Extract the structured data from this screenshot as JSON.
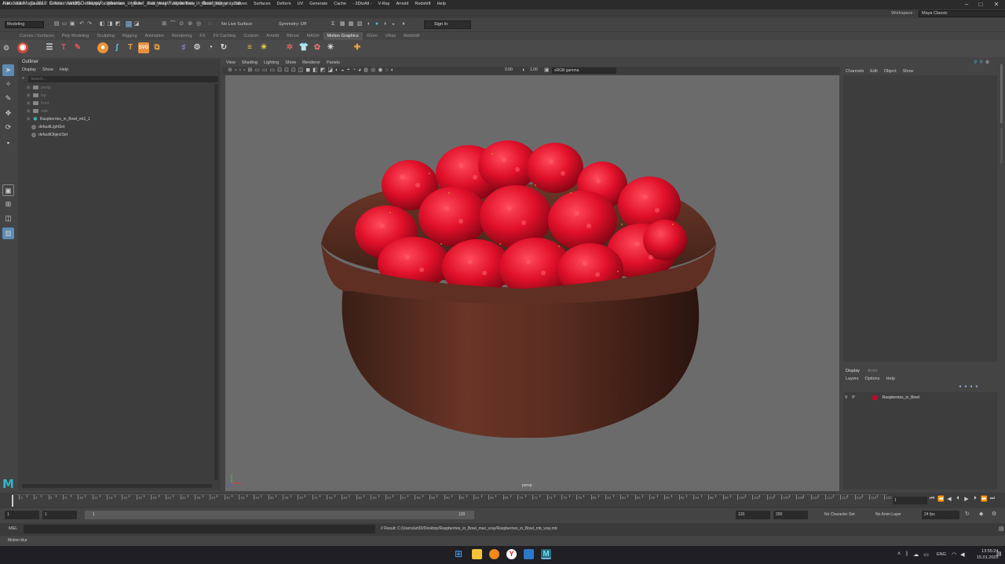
{
  "window": {
    "title": "Autodesk Maya 2018: C:\\Users\\art30\\Desktop\\Raspberries_in_Bowl_max_vray\\Raspberries_in_Bowl_mb_vray.mb",
    "minimize_glyph": "–",
    "maximize_glyph": "□",
    "close_glyph": "✕"
  },
  "menubar": {
    "items": [
      "File",
      "Edit",
      "Create",
      "Select",
      "Modify",
      "Display",
      "Windows",
      "Mesh",
      "Edit Mesh",
      "Mesh Tools",
      "Mesh Display",
      "Curves",
      "Surfaces",
      "Deform",
      "UV",
      "Generate",
      "Cache",
      "- 3DtoAll -",
      "V-Ray",
      "Arnold",
      "Redshift",
      "Help"
    ],
    "workspace_label": "Workspace :",
    "workspace_value": "Maya Classic"
  },
  "statusline": {
    "mode": "Modeling",
    "live_surface": "No Live Surface",
    "symmetry": "Symmetry: Off",
    "sign_in": "Sign In"
  },
  "shelf": {
    "tabs": [
      "Curves / Surfaces",
      "Poly Modeling",
      "Sculpting",
      "Rigging",
      "Animation",
      "Rendering",
      "FX",
      "FX Caching",
      "Custom",
      "Arnold",
      "Bifrost",
      "MASH",
      "Motion Graphics",
      "XGen",
      "VRay",
      "Redshift"
    ],
    "active_tab": "Motion Graphics"
  },
  "outliner": {
    "title": "Outliner",
    "menus": [
      "Display",
      "Show",
      "Help"
    ],
    "search_placeholder": "Search...",
    "items": [
      {
        "label": "persp",
        "icon": "camera-icon",
        "dim": true
      },
      {
        "label": "top",
        "icon": "camera-icon",
        "dim": true
      },
      {
        "label": "front",
        "icon": "camera-icon",
        "dim": true
      },
      {
        "label": "side",
        "icon": "camera-icon",
        "dim": true
      },
      {
        "label": "Raspberries_in_Bowl_mt1_1",
        "icon": "group-icon",
        "dim": false
      },
      {
        "label": "defaultLightSet",
        "icon": "set-icon",
        "dim": false
      },
      {
        "label": "defaultObjectSet",
        "icon": "set-icon",
        "dim": false
      }
    ]
  },
  "viewport": {
    "menus": [
      "View",
      "Shading",
      "Lighting",
      "Show",
      "Renderer",
      "Panels"
    ],
    "exposure": "0.00",
    "gamma": "1.00",
    "color_space": "sRGB gamma",
    "camera_label": "persp"
  },
  "channel_box": {
    "menus": [
      "Channels",
      "Edit",
      "Object",
      "Show"
    ]
  },
  "layer_editor": {
    "tabs": [
      "Display",
      "Anim"
    ],
    "active_tab": "Display",
    "menus": [
      "Layers",
      "Options",
      "Help"
    ],
    "layer": {
      "v": "V",
      "p": "P",
      "name": "Raspberries_in_Bowl",
      "color": "#b01030"
    }
  },
  "timeline": {
    "ticks": [
      "2",
      "4",
      "6",
      "8",
      "10",
      "12",
      "14",
      "16",
      "18",
      "20",
      "22",
      "24",
      "26",
      "28",
      "30",
      "32",
      "34",
      "36",
      "38",
      "40",
      "42",
      "44",
      "46",
      "48",
      "50",
      "52",
      "54",
      "56",
      "58",
      "60",
      "62",
      "64",
      "66",
      "68",
      "70",
      "72",
      "74",
      "76",
      "78",
      "80",
      "82",
      "84",
      "86",
      "88",
      "90",
      "92",
      "94",
      "96",
      "98",
      "100",
      "102",
      "104",
      "106",
      "108",
      "110",
      "112",
      "114",
      "116",
      "118",
      "120"
    ],
    "current_frame": "1",
    "playback_glyphs": [
      "⏮",
      "⏪",
      "◀",
      "⏴",
      "▶",
      "⏵",
      "⏩",
      "⏭"
    ]
  },
  "range": {
    "start": "1",
    "anim_start": "1",
    "slider_start": "1",
    "slider_end": "120",
    "end": "120",
    "anim_end": "200",
    "character_set": "No Character Set",
    "anim_layer": "No Anim Layer",
    "fps": "24 fps"
  },
  "command": {
    "mel_label": "MEL",
    "result": "// Result: C:/Users/art30/Desktop/Raspberries_in_Bowl_max_vray/Raspberries_in_Bowl_mb_vray.mb"
  },
  "helpline": {
    "text": "Motion blur"
  },
  "taskbar": {
    "language": "ENG",
    "time": "13:55:24",
    "date": "15.01.2025"
  }
}
